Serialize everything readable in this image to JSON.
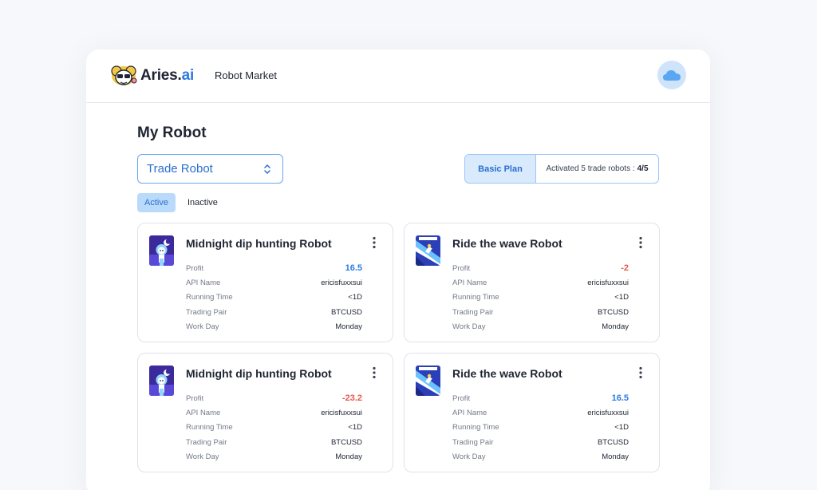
{
  "brand": {
    "name_main": "Aries.",
    "name_accent": "ai"
  },
  "nav": {
    "robot_market": "Robot Market"
  },
  "page": {
    "title": "My Robot"
  },
  "select": {
    "value": "Trade Robot"
  },
  "plan": {
    "name": "Basic Plan",
    "info": "Activated 5 trade robots :",
    "count": "4/5"
  },
  "tabs": [
    {
      "label": "Active",
      "active": true
    },
    {
      "label": "Inactive",
      "active": false
    }
  ],
  "colors": {
    "accent": "#2b7be5",
    "positive": "#2b7be5",
    "negative": "#e5594a"
  },
  "cards": [
    {
      "title": "Midnight dip hunting Robot",
      "icon": "midnight-robot-avatar-icon",
      "fields": [
        {
          "label": "Profit",
          "value": "16.5",
          "sign": "pos"
        },
        {
          "label": "API Name",
          "value": "ericisfuxxsui"
        },
        {
          "label": "Running Time",
          "value": "<1D"
        },
        {
          "label": "Trading Pair",
          "value": "BTCUSD"
        },
        {
          "label": "Work Day",
          "value": "Monday"
        }
      ]
    },
    {
      "title": "Ride the wave Robot",
      "icon": "wave-robot-avatar-icon",
      "fields": [
        {
          "label": "Profit",
          "value": "-2",
          "sign": "neg"
        },
        {
          "label": "API Name",
          "value": "ericisfuxxsui"
        },
        {
          "label": "Running Time",
          "value": "<1D"
        },
        {
          "label": "Trading Pair",
          "value": "BTCUSD"
        },
        {
          "label": "Work Day",
          "value": "Monday"
        }
      ]
    },
    {
      "title": "Midnight dip hunting Robot",
      "icon": "midnight-robot-avatar-icon",
      "fields": [
        {
          "label": "Profit",
          "value": "-23.2",
          "sign": "neg"
        },
        {
          "label": "API Name",
          "value": "ericisfuxxsui"
        },
        {
          "label": "Running Time",
          "value": "<1D"
        },
        {
          "label": "Trading Pair",
          "value": "BTCUSD"
        },
        {
          "label": "Work Day",
          "value": "Monday"
        }
      ]
    },
    {
      "title": "Ride the wave Robot",
      "icon": "wave-robot-avatar-icon",
      "fields": [
        {
          "label": "Profit",
          "value": "16.5",
          "sign": "pos"
        },
        {
          "label": "API Name",
          "value": "ericisfuxxsui"
        },
        {
          "label": "Running Time",
          "value": "<1D"
        },
        {
          "label": "Trading Pair",
          "value": "BTCUSD"
        },
        {
          "label": "Work Day",
          "value": "Monday"
        }
      ]
    }
  ]
}
